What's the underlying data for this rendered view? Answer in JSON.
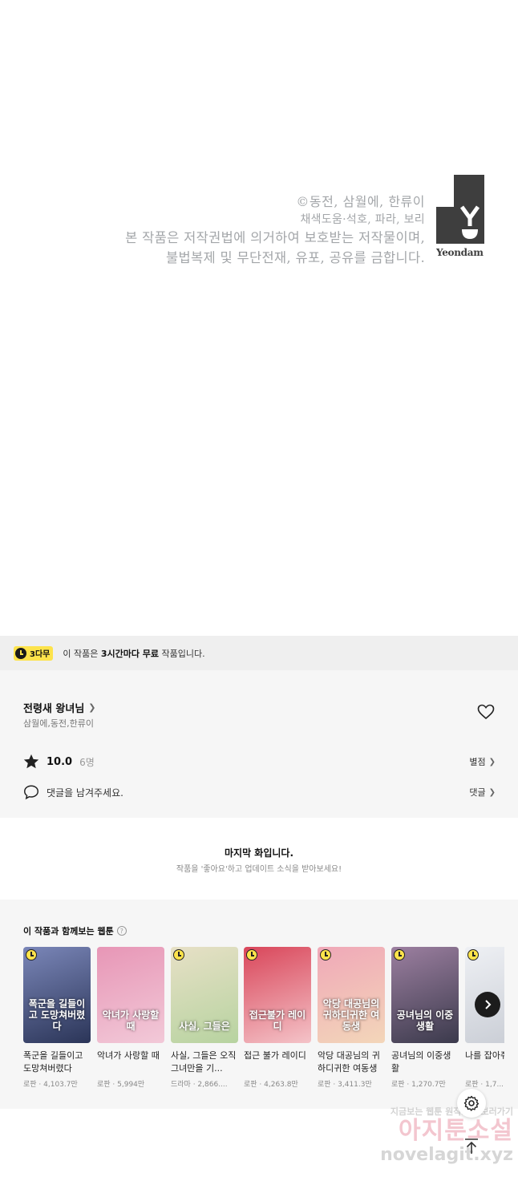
{
  "credits": {
    "line1": "©동전, 삼월에, 한류이",
    "line2": "채색도움·석호, 파라, 보리",
    "line3": "본 작품은 저작권법에 의거하여 보호받는 저작물이며,",
    "line4": "불법복제 및 무단전재, 유포, 공유를 금합니다.",
    "logo_text": "Yeondam"
  },
  "free_banner": {
    "badge": "3다무",
    "text_prefix": "이 작품은 ",
    "text_bold": "3시간마다 무료",
    "text_suffix": " 작품입니다.",
    "badge_color": "#fde34b"
  },
  "series": {
    "title": "전령새 왕녀님",
    "authors": "삼월에,동전,한류이",
    "rating": "10.0",
    "rating_count": "6명",
    "rate_link": "별점",
    "comment_prompt": "댓글을 남겨주세요.",
    "comment_link": "댓글"
  },
  "last_episode": {
    "title": "마지막 화입니다.",
    "subtitle": "작품을 '좋아요'하고 업데이트 소식을 받아보세요!"
  },
  "recommendations": {
    "heading": "이 작품과 함께보는 웹툰",
    "help": "?",
    "items": [
      {
        "name": "폭군을 길들이고 도망쳐버렸다",
        "meta": "로판 · 4,103.7만",
        "cover": "폭군을 길들이고 도망쳐버렸다",
        "bg": "#2b3558",
        "bg2": "#7a86b8",
        "clock": true
      },
      {
        "name": "악녀가 사랑할 때",
        "meta": "로판 · 5,994만",
        "cover": "악녀가 사랑할 때",
        "bg": "#f2c9d8",
        "bg2": "#e796b6",
        "clock": false
      },
      {
        "name": "사실, 그들은 오직 그녀만을 기...",
        "meta": "드라마 · 2,866....",
        "cover": "사실, 그들은",
        "bg": "#b7d3a0",
        "bg2": "#e7e0c6",
        "clock": true
      },
      {
        "name": "접근 불가 레이디",
        "meta": "로판 · 4,263.8만",
        "cover": "접근불가 레이디",
        "bg": "#f4c3c8",
        "bg2": "#d9465a",
        "clock": true
      },
      {
        "name": "악당 대공님의 귀하디귀한 여동생",
        "meta": "로판 · 3,411.3만",
        "cover": "악당 대공님의 귀하디귀한 여동생",
        "bg": "#f3d6b9",
        "bg2": "#f0a8b8",
        "clock": true
      },
      {
        "name": "공녀님의 이중생활",
        "meta": "로판 · 1,270.7만",
        "cover": "공녀님의 이중생활",
        "bg": "#3b3a4c",
        "bg2": "#9c7fa0",
        "clock": true
      },
      {
        "name": "나를 잡아줘",
        "meta": "로판 · 1,7...",
        "cover": "",
        "bg": "#c8ccd4",
        "bg2": "#eef0f4",
        "clock": true
      }
    ]
  },
  "watermark": {
    "tagline": "지금보는 웹툰 원작소설 보러가기",
    "brand": "아지툰소설",
    "domain": "novelagit.xyz"
  },
  "icons": {
    "heart": "heart-icon",
    "star": "star-icon",
    "comment": "comment-icon",
    "settings": "gear-icon",
    "top": "arrow-up-icon",
    "next": "chevron-right-icon"
  }
}
